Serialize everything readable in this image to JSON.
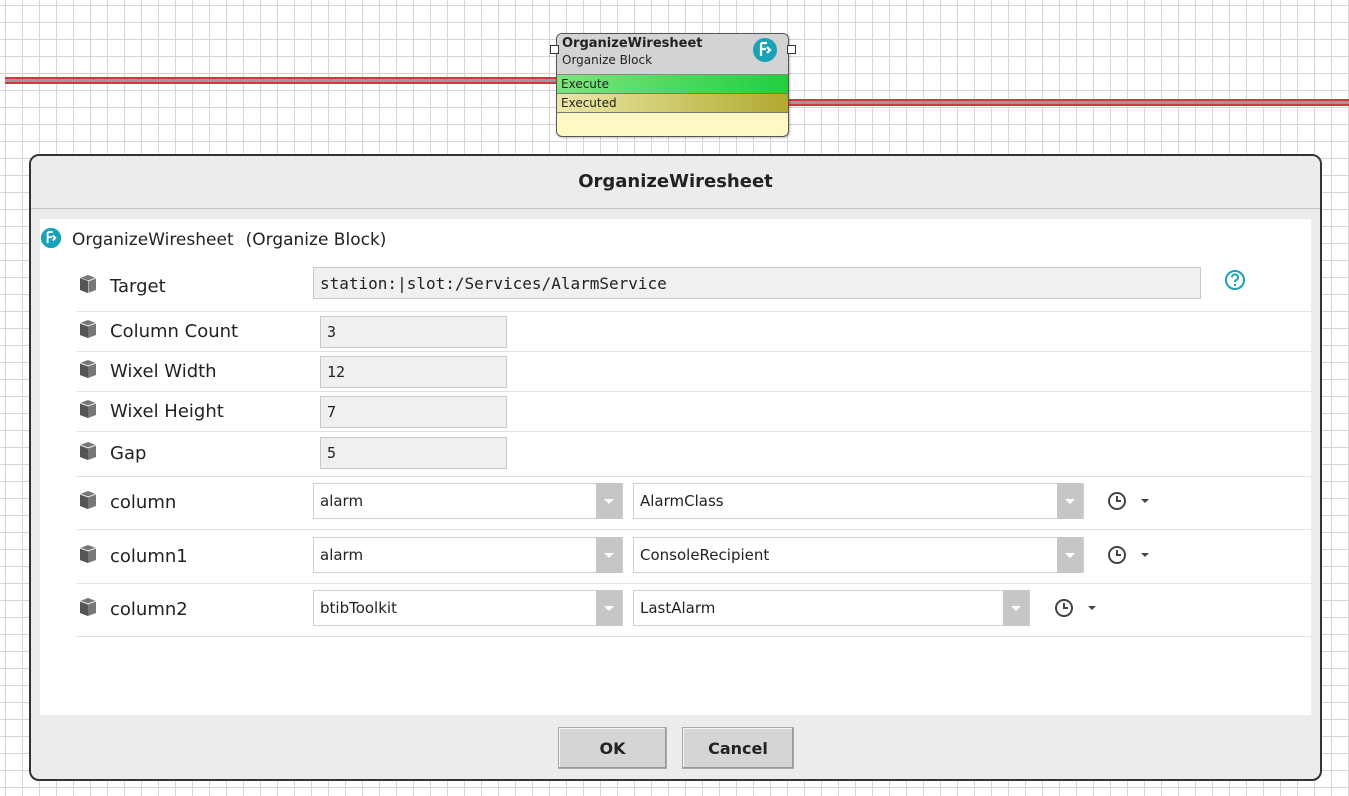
{
  "block": {
    "name": "OrganizeWiresheet",
    "type": "Organize Block",
    "slots": [
      "Execute",
      "Executed"
    ],
    "icon": "organize-block-icon"
  },
  "dialog": {
    "title": "OrganizeWiresheet",
    "header_name": "OrganizeWiresheet",
    "header_type": "(Organize Block)",
    "rows": [
      {
        "label": "Target",
        "value": "station:|slot:/Services/AlarmService"
      },
      {
        "label": "Column Count",
        "value": "3"
      },
      {
        "label": "Wixel Width",
        "value": "12"
      },
      {
        "label": "Wixel Height",
        "value": "7"
      },
      {
        "label": "Gap",
        "value": "5"
      },
      {
        "label": "column",
        "module": "alarm",
        "type": "AlarmClass"
      },
      {
        "label": "column1",
        "module": "alarm",
        "type": "ConsoleRecipient"
      },
      {
        "label": "column2",
        "module": "btibToolkit",
        "type": "LastAlarm"
      }
    ],
    "ok_label": "OK",
    "cancel_label": "Cancel"
  },
  "colors": {
    "accent": "#1aa3b8",
    "wire": "#d13a3a",
    "execute_slot": "#1fcf3f",
    "executed_slot": "#b0aa2e",
    "block_body": "#fdf8c4"
  },
  "icons": [
    "organize-block-icon",
    "property-cube-icon",
    "help-icon",
    "history-icon",
    "chevron-down-icon"
  ]
}
